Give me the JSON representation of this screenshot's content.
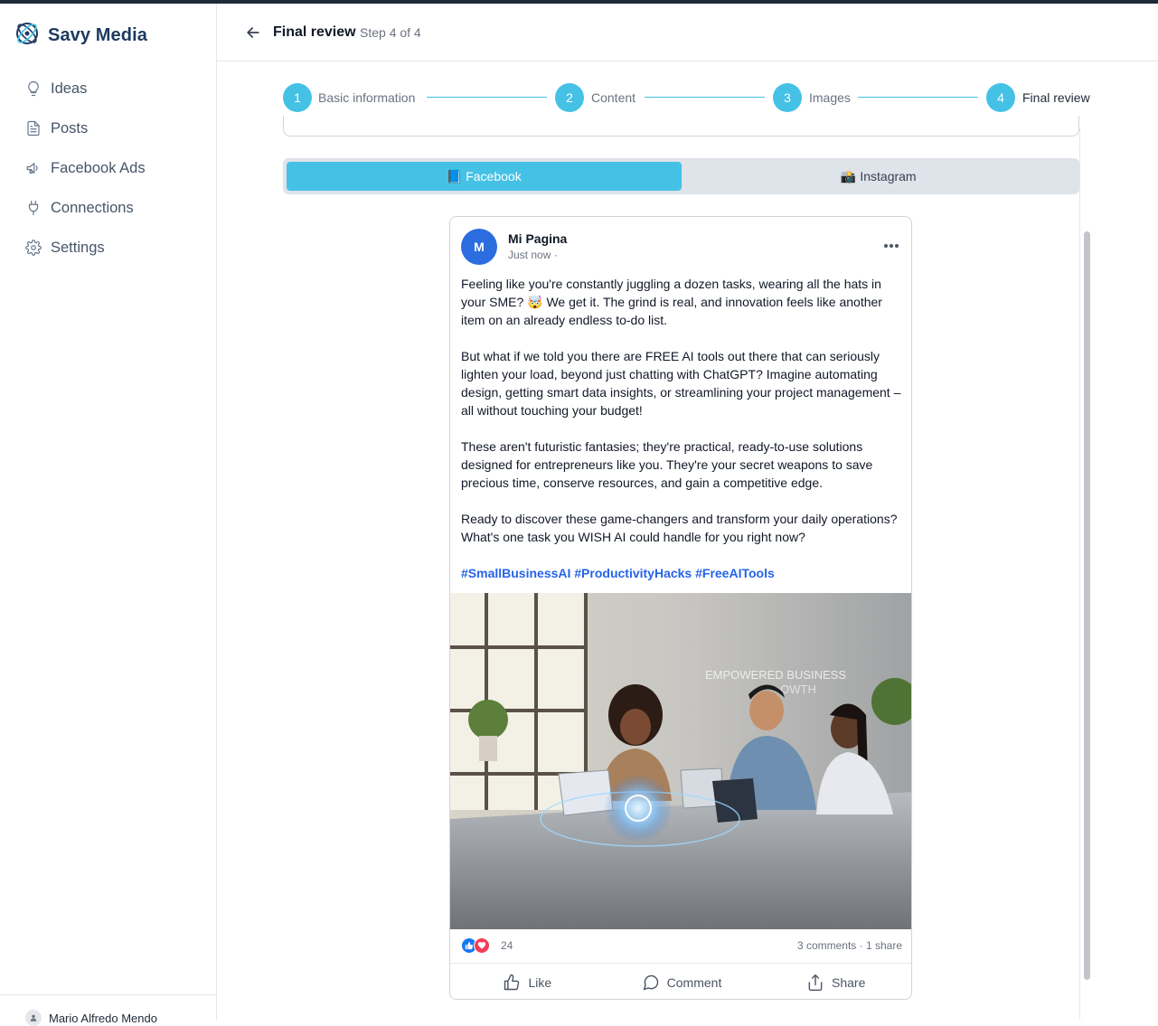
{
  "app": {
    "name": "Savy Media"
  },
  "sidebar": {
    "items": [
      {
        "label": "Ideas",
        "icon": "lightbulb-icon"
      },
      {
        "label": "Posts",
        "icon": "document-icon"
      },
      {
        "label": "Facebook Ads",
        "icon": "megaphone-icon"
      },
      {
        "label": "Connections",
        "icon": "plug-icon"
      },
      {
        "label": "Settings",
        "icon": "gear-icon"
      }
    ],
    "user": {
      "name": "Mario Alfredo Mendo"
    }
  },
  "header": {
    "title": "Final review",
    "step": "Step 4 of 4"
  },
  "stepper": {
    "steps": [
      {
        "number": "1",
        "label": "Basic information"
      },
      {
        "number": "2",
        "label": "Content"
      },
      {
        "number": "3",
        "label": "Images"
      },
      {
        "number": "4",
        "label": "Final review"
      }
    ],
    "accent": "#45c1e6"
  },
  "platform_tabs": [
    {
      "emoji": "📘",
      "label": "Facebook",
      "active": true
    },
    {
      "emoji": "📸",
      "label": "Instagram",
      "active": false
    }
  ],
  "post": {
    "avatar_letter": "M",
    "page_name": "Mi Pagina",
    "time": "Just now ·",
    "paragraphs": [
      "Feeling like you're constantly juggling a dozen tasks, wearing all the hats in your SME? 🤯 We get it. The grind is real, and innovation feels like another item on an already endless to-do list.",
      "But what if we told you there are FREE AI tools out there that can seriously lighten your load, beyond just chatting with ChatGPT? Imagine automating design, getting smart data insights, or streamlining your project management – all without touching your budget!",
      "These aren't futuristic fantasies; they're practical, ready-to-use solutions designed for entrepreneurs like you. They're your secret weapons to save precious time, conserve resources, and gain a competitive edge.",
      "Ready to discover these game-changers and transform your daily operations? What's one task you WISH AI could handle for you right now?"
    ],
    "hashtags": "#SmallBusinessAI #ProductivityHacks #FreeAITools",
    "image_text": "EMPOWERED BUSINESS GROWTH",
    "reaction_count": "24",
    "engagement": "3 comments · 1 share",
    "actions": {
      "like": "Like",
      "comment": "Comment",
      "share": "Share"
    }
  },
  "colors": {
    "brand": "#1e3a5f",
    "accent": "#45c1e6",
    "link": "#2563eb",
    "fb_blue": "#2b6ddf"
  }
}
